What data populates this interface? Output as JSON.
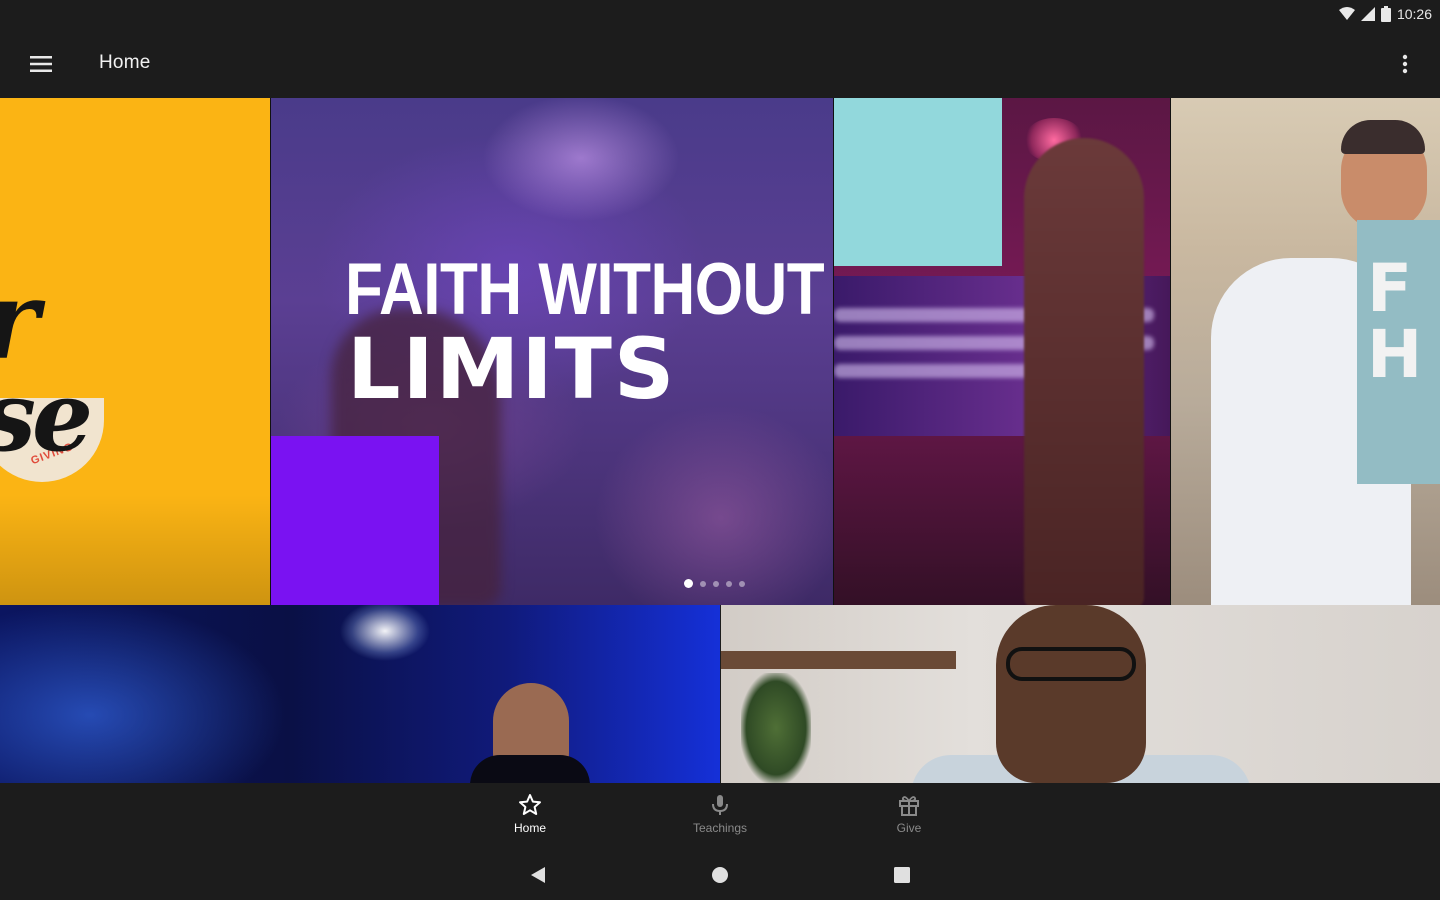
{
  "status_bar": {
    "time": "10:26"
  },
  "app_bar": {
    "title": "Home",
    "menu_icon": "hamburger-menu-icon",
    "overflow_icon": "more-vert-icon"
  },
  "carousel": {
    "left_slide": {
      "text_line_1": "r",
      "text_line_2": "se",
      "badge_text": "GIVING"
    },
    "main_slide": {
      "headline_line_1": "FAITH WITHOUT",
      "headline_line_2": "LIMITS"
    },
    "right_slide": {
      "sign_text": "F\nH"
    },
    "page_count": 5,
    "active_page": 1
  },
  "bottom_nav": {
    "items": [
      {
        "label": "Home",
        "icon": "star-icon",
        "active": true
      },
      {
        "label": "Teachings",
        "icon": "microphone-icon",
        "active": false
      },
      {
        "label": "Give",
        "icon": "gift-icon",
        "active": false
      }
    ]
  },
  "colors": {
    "background": "#1c1c1c",
    "accent_yellow": "#fbb414",
    "accent_violet": "#7a12f2",
    "accent_teal": "#92d8dc",
    "inactive_label": "#8a8a8a"
  }
}
